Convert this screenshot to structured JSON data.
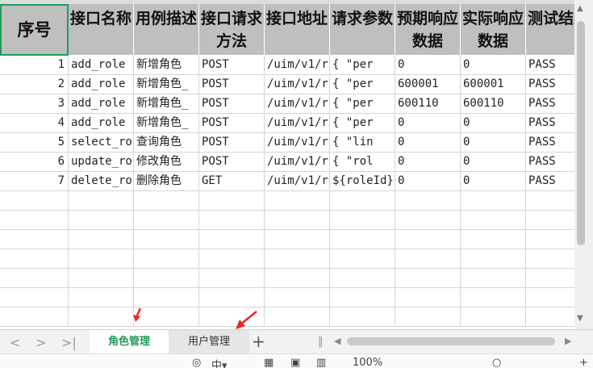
{
  "headers": [
    "序号",
    "接口名称",
    "用例描述",
    "接口请求方法",
    "接口地址",
    "请求参数",
    "预期响应数据",
    "实际响应数据",
    "测试结果"
  ],
  "rows": [
    {
      "id": "1",
      "name": "add_role",
      "desc": "新增角色",
      "method": "POST",
      "url": "/uim/v1/r",
      "params": "{     \"per",
      "expected": "0",
      "actual": "0",
      "result": "PASS"
    },
    {
      "id": "2",
      "name": "add_role",
      "desc": "新增角色_",
      "method": "POST",
      "url": "/uim/v1/r",
      "params": "{     \"per",
      "expected": "600001",
      "actual": "600001",
      "result": "PASS"
    },
    {
      "id": "3",
      "name": "add_role",
      "desc": "新增角色_",
      "method": "POST",
      "url": "/uim/v1/r",
      "params": "{     \"per",
      "expected": "600110",
      "actual": "600110",
      "result": "PASS"
    },
    {
      "id": "4",
      "name": "add_role",
      "desc": "新增角色_",
      "method": "POST",
      "url": "/uim/v1/r",
      "params": "{     \"per",
      "expected": "0",
      "actual": "0",
      "result": "PASS"
    },
    {
      "id": "5",
      "name": "select_ro",
      "desc": "查询角色",
      "method": "POST",
      "url": "/uim/v1/r",
      "params": "{     \"lin",
      "expected": "0",
      "actual": "0",
      "result": "PASS"
    },
    {
      "id": "6",
      "name": "update_ro",
      "desc": "修改角色",
      "method": "POST",
      "url": "/uim/v1/r",
      "params": "{     \"rol",
      "expected": "0",
      "actual": "0",
      "result": "PASS"
    },
    {
      "id": "7",
      "name": "delete_ro",
      "desc": "删除角色",
      "method": "GET",
      "url": "/uim/v1/r",
      "params": "${roleId}",
      "expected": "0",
      "actual": "0",
      "result": "PASS"
    }
  ],
  "tabs": {
    "active": "角色管理",
    "inactive": "用户管理",
    "add": "+"
  },
  "status": {
    "zoom": "100%"
  },
  "colors": {
    "accent": "#1e9b54",
    "header_bg": "#bfbfbf",
    "annotation_arrow": "#e8291c"
  }
}
